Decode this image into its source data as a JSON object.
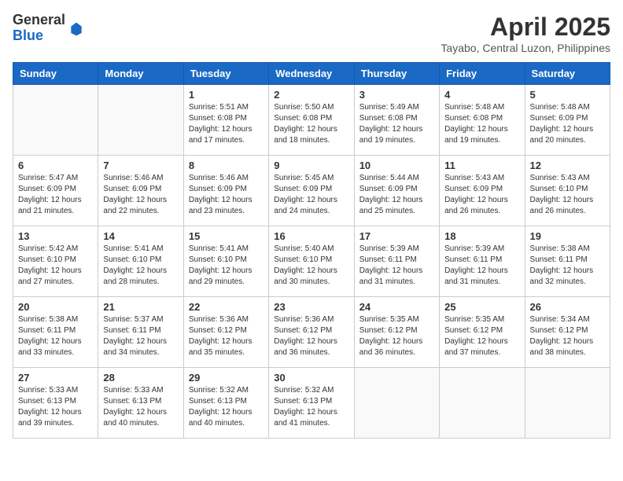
{
  "header": {
    "logo_general": "General",
    "logo_blue": "Blue",
    "month_year": "April 2025",
    "location": "Tayabo, Central Luzon, Philippines"
  },
  "calendar": {
    "days_of_week": [
      "Sunday",
      "Monday",
      "Tuesday",
      "Wednesday",
      "Thursday",
      "Friday",
      "Saturday"
    ],
    "weeks": [
      [
        {
          "day": "",
          "sunrise": "",
          "sunset": "",
          "daylight": ""
        },
        {
          "day": "",
          "sunrise": "",
          "sunset": "",
          "daylight": ""
        },
        {
          "day": "1",
          "sunrise": "Sunrise: 5:51 AM",
          "sunset": "Sunset: 6:08 PM",
          "daylight": "Daylight: 12 hours and 17 minutes."
        },
        {
          "day": "2",
          "sunrise": "Sunrise: 5:50 AM",
          "sunset": "Sunset: 6:08 PM",
          "daylight": "Daylight: 12 hours and 18 minutes."
        },
        {
          "day": "3",
          "sunrise": "Sunrise: 5:49 AM",
          "sunset": "Sunset: 6:08 PM",
          "daylight": "Daylight: 12 hours and 19 minutes."
        },
        {
          "day": "4",
          "sunrise": "Sunrise: 5:48 AM",
          "sunset": "Sunset: 6:08 PM",
          "daylight": "Daylight: 12 hours and 19 minutes."
        },
        {
          "day": "5",
          "sunrise": "Sunrise: 5:48 AM",
          "sunset": "Sunset: 6:09 PM",
          "daylight": "Daylight: 12 hours and 20 minutes."
        }
      ],
      [
        {
          "day": "6",
          "sunrise": "Sunrise: 5:47 AM",
          "sunset": "Sunset: 6:09 PM",
          "daylight": "Daylight: 12 hours and 21 minutes."
        },
        {
          "day": "7",
          "sunrise": "Sunrise: 5:46 AM",
          "sunset": "Sunset: 6:09 PM",
          "daylight": "Daylight: 12 hours and 22 minutes."
        },
        {
          "day": "8",
          "sunrise": "Sunrise: 5:46 AM",
          "sunset": "Sunset: 6:09 PM",
          "daylight": "Daylight: 12 hours and 23 minutes."
        },
        {
          "day": "9",
          "sunrise": "Sunrise: 5:45 AM",
          "sunset": "Sunset: 6:09 PM",
          "daylight": "Daylight: 12 hours and 24 minutes."
        },
        {
          "day": "10",
          "sunrise": "Sunrise: 5:44 AM",
          "sunset": "Sunset: 6:09 PM",
          "daylight": "Daylight: 12 hours and 25 minutes."
        },
        {
          "day": "11",
          "sunrise": "Sunrise: 5:43 AM",
          "sunset": "Sunset: 6:09 PM",
          "daylight": "Daylight: 12 hours and 26 minutes."
        },
        {
          "day": "12",
          "sunrise": "Sunrise: 5:43 AM",
          "sunset": "Sunset: 6:10 PM",
          "daylight": "Daylight: 12 hours and 26 minutes."
        }
      ],
      [
        {
          "day": "13",
          "sunrise": "Sunrise: 5:42 AM",
          "sunset": "Sunset: 6:10 PM",
          "daylight": "Daylight: 12 hours and 27 minutes."
        },
        {
          "day": "14",
          "sunrise": "Sunrise: 5:41 AM",
          "sunset": "Sunset: 6:10 PM",
          "daylight": "Daylight: 12 hours and 28 minutes."
        },
        {
          "day": "15",
          "sunrise": "Sunrise: 5:41 AM",
          "sunset": "Sunset: 6:10 PM",
          "daylight": "Daylight: 12 hours and 29 minutes."
        },
        {
          "day": "16",
          "sunrise": "Sunrise: 5:40 AM",
          "sunset": "Sunset: 6:10 PM",
          "daylight": "Daylight: 12 hours and 30 minutes."
        },
        {
          "day": "17",
          "sunrise": "Sunrise: 5:39 AM",
          "sunset": "Sunset: 6:11 PM",
          "daylight": "Daylight: 12 hours and 31 minutes."
        },
        {
          "day": "18",
          "sunrise": "Sunrise: 5:39 AM",
          "sunset": "Sunset: 6:11 PM",
          "daylight": "Daylight: 12 hours and 31 minutes."
        },
        {
          "day": "19",
          "sunrise": "Sunrise: 5:38 AM",
          "sunset": "Sunset: 6:11 PM",
          "daylight": "Daylight: 12 hours and 32 minutes."
        }
      ],
      [
        {
          "day": "20",
          "sunrise": "Sunrise: 5:38 AM",
          "sunset": "Sunset: 6:11 PM",
          "daylight": "Daylight: 12 hours and 33 minutes."
        },
        {
          "day": "21",
          "sunrise": "Sunrise: 5:37 AM",
          "sunset": "Sunset: 6:11 PM",
          "daylight": "Daylight: 12 hours and 34 minutes."
        },
        {
          "day": "22",
          "sunrise": "Sunrise: 5:36 AM",
          "sunset": "Sunset: 6:12 PM",
          "daylight": "Daylight: 12 hours and 35 minutes."
        },
        {
          "day": "23",
          "sunrise": "Sunrise: 5:36 AM",
          "sunset": "Sunset: 6:12 PM",
          "daylight": "Daylight: 12 hours and 36 minutes."
        },
        {
          "day": "24",
          "sunrise": "Sunrise: 5:35 AM",
          "sunset": "Sunset: 6:12 PM",
          "daylight": "Daylight: 12 hours and 36 minutes."
        },
        {
          "day": "25",
          "sunrise": "Sunrise: 5:35 AM",
          "sunset": "Sunset: 6:12 PM",
          "daylight": "Daylight: 12 hours and 37 minutes."
        },
        {
          "day": "26",
          "sunrise": "Sunrise: 5:34 AM",
          "sunset": "Sunset: 6:12 PM",
          "daylight": "Daylight: 12 hours and 38 minutes."
        }
      ],
      [
        {
          "day": "27",
          "sunrise": "Sunrise: 5:33 AM",
          "sunset": "Sunset: 6:13 PM",
          "daylight": "Daylight: 12 hours and 39 minutes."
        },
        {
          "day": "28",
          "sunrise": "Sunrise: 5:33 AM",
          "sunset": "Sunset: 6:13 PM",
          "daylight": "Daylight: 12 hours and 40 minutes."
        },
        {
          "day": "29",
          "sunrise": "Sunrise: 5:32 AM",
          "sunset": "Sunset: 6:13 PM",
          "daylight": "Daylight: 12 hours and 40 minutes."
        },
        {
          "day": "30",
          "sunrise": "Sunrise: 5:32 AM",
          "sunset": "Sunset: 6:13 PM",
          "daylight": "Daylight: 12 hours and 41 minutes."
        },
        {
          "day": "",
          "sunrise": "",
          "sunset": "",
          "daylight": ""
        },
        {
          "day": "",
          "sunrise": "",
          "sunset": "",
          "daylight": ""
        },
        {
          "day": "",
          "sunrise": "",
          "sunset": "",
          "daylight": ""
        }
      ]
    ]
  }
}
